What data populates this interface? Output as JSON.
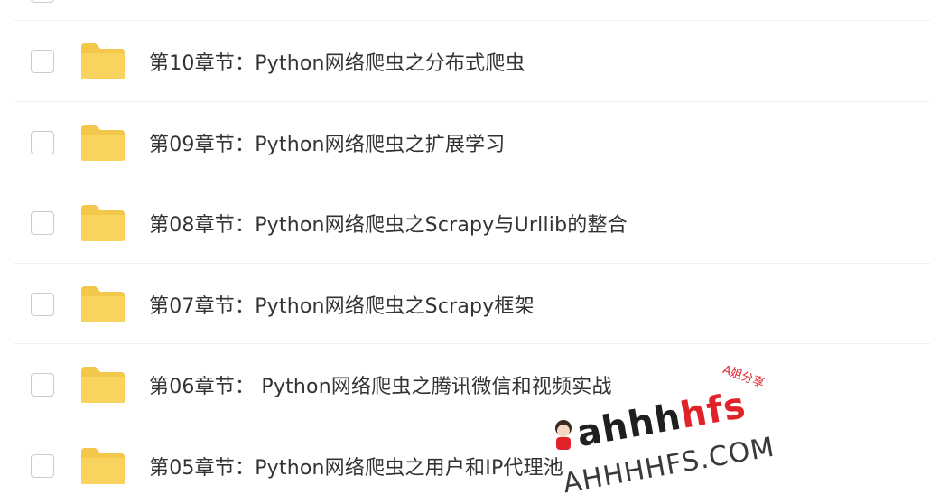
{
  "file_list": {
    "items": [
      {
        "name": "第10章节：Python网络爬虫之分布式爬虫",
        "icon": "folder-icon"
      },
      {
        "name": "第09章节：Python网络爬虫之扩展学习",
        "icon": "folder-icon"
      },
      {
        "name": "第08章节：Python网络爬虫之Scrapy与Urllib的整合",
        "icon": "folder-icon"
      },
      {
        "name": "第07章节：Python网络爬虫之Scrapy框架",
        "icon": "folder-icon"
      },
      {
        "name": "第06章节： Python网络爬虫之腾讯微信和视频实战",
        "icon": "folder-icon"
      },
      {
        "name": "第05章节：Python网络爬虫之用户和IP代理池",
        "icon": "folder-icon"
      }
    ]
  },
  "watermark": {
    "tag": "A姐分享",
    "main_prefix": "ahhh",
    "main_accent": "hfs",
    "sub": "AHHHHFS.COM"
  },
  "colors": {
    "folder": "#f8d35e",
    "folder_tab": "#f3c74a",
    "text": "#333333",
    "divider": "#eeeff2",
    "checkbox_border": "#c8cbd1"
  }
}
